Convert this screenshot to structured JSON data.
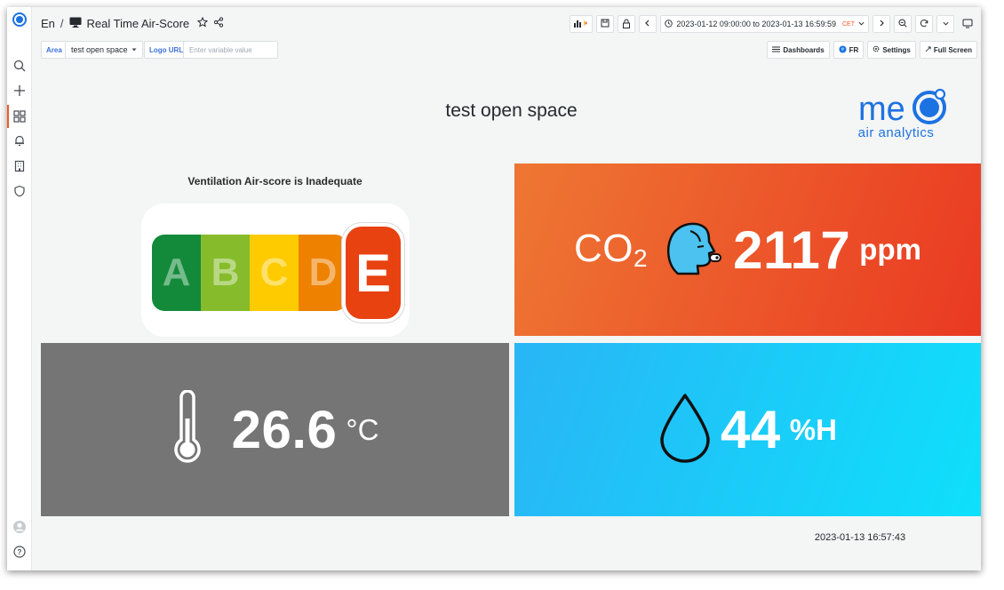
{
  "nav": {
    "org": "En",
    "separator": "/",
    "dashboard_title": "Real Time Air-Score"
  },
  "time": {
    "range": "2023-01-12 09:00:00 to 2023-01-13 16:59:59",
    "zone": "CET"
  },
  "variables": {
    "area_label": "Area",
    "area_value": "test open space",
    "logo_label": "Logo URL",
    "logo_placeholder": "Enter variable value"
  },
  "links": {
    "dashboards": "Dashboards",
    "fr": "FR",
    "settings": "Settings",
    "full_screen": "Full Screen"
  },
  "page": {
    "title": "test open space",
    "logo_text": "me",
    "logo_sub": "air analytics",
    "logo_color": "#1d72e2"
  },
  "score": {
    "title": "Ventilation Air-score is Inadequate",
    "grades": [
      {
        "letter": "A",
        "color": "#138a3a"
      },
      {
        "letter": "B",
        "color": "#86bc2b"
      },
      {
        "letter": "C",
        "color": "#fecb00"
      },
      {
        "letter": "D",
        "color": "#ee8100"
      }
    ],
    "selected": "E",
    "selected_color": "#e84211"
  },
  "metrics": {
    "co2": {
      "label": "CO",
      "sub": "2",
      "value": "2117",
      "unit": "ppm"
    },
    "temperature": {
      "value": "26.6",
      "unit": "°C"
    },
    "humidity": {
      "value": "44",
      "unit": "%H"
    }
  },
  "footer": {
    "timestamp": "2023-01-13 16:57:43"
  },
  "icons": [
    "grafana-logo-icon",
    "search-icon",
    "plus-icon",
    "dashboards-icon",
    "bell-icon",
    "building-icon",
    "shield-icon",
    "user-icon",
    "help-icon",
    "monitor-icon",
    "star-icon",
    "share-icon",
    "add-panel-icon",
    "save-icon",
    "lock-icon",
    "chevron-left-icon",
    "clock-icon",
    "chevron-down-icon",
    "chevron-right-icon",
    "zoom-out-icon",
    "refresh-icon",
    "tv-icon",
    "list-icon",
    "globe-icon",
    "gear-icon",
    "expand-icon",
    "breathing-head-icon",
    "thermometer-icon",
    "water-drop-icon"
  ]
}
